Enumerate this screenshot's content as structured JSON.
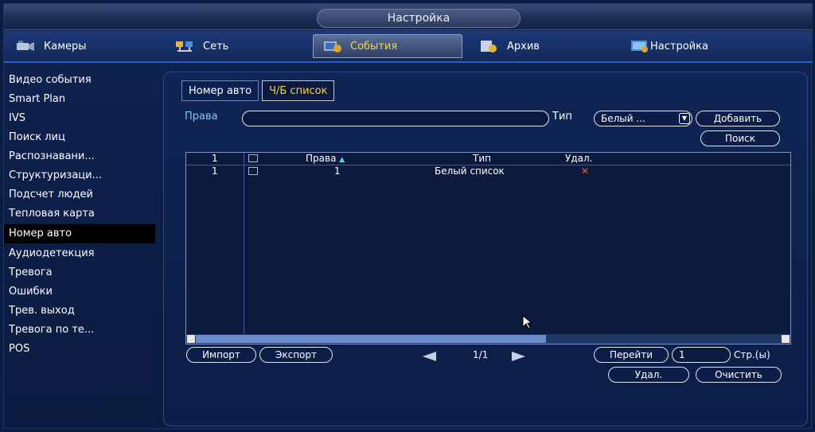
{
  "title": "Настройка",
  "top_tabs": [
    {
      "label": "Камеры",
      "icon": "camera-icon"
    },
    {
      "label": "Сеть",
      "icon": "network-icon"
    },
    {
      "label": "События",
      "icon": "events-icon",
      "active": true
    },
    {
      "label": "Архив",
      "icon": "archive-icon"
    },
    {
      "label": "Настройка",
      "icon": "settings-icon"
    }
  ],
  "sidebar": {
    "items": [
      {
        "label": "Видео события"
      },
      {
        "label": "Smart Plan"
      },
      {
        "label": "IVS"
      },
      {
        "label": "Поиск лиц"
      },
      {
        "label": "Распознавани..."
      },
      {
        "label": "Структуризаци..."
      },
      {
        "label": "Подсчет людей"
      },
      {
        "label": "Тепловая карта"
      },
      {
        "label": "Номер авто",
        "active": true
      },
      {
        "label": "Аудиодетекция"
      },
      {
        "label": "Тревога"
      },
      {
        "label": "Ошибки"
      },
      {
        "label": "Трев. выход"
      },
      {
        "label": "Тревога по те..."
      },
      {
        "label": "POS"
      }
    ]
  },
  "subtabs": [
    {
      "label": "Номер авто"
    },
    {
      "label": "Ч/Б список",
      "active": true
    }
  ],
  "filter": {
    "rights_label": "Права",
    "rights_value": "",
    "type_label": "Тип",
    "type_value": "Белый ...",
    "add_button": "Добавить",
    "search_button": "Поиск"
  },
  "table": {
    "headers": {
      "index": "1",
      "rights": "Права",
      "type": "Тип",
      "delete": "Удал."
    },
    "rows": [
      {
        "index": "1",
        "rights": "1",
        "type": "Белый список",
        "delete": "✕"
      }
    ]
  },
  "footer": {
    "import_button": "Импорт",
    "export_button": "Экспорт",
    "page": "1/1",
    "goto_button": "Перейти",
    "goto_value": "1",
    "pages_label": "Стр.(ы)",
    "delete_button": "Удал.",
    "clear_button": "Очистить"
  },
  "colors": {
    "accent": "#ffd23c",
    "label_blue": "#7ec8ff",
    "delete_x": "#ff5a1e"
  }
}
